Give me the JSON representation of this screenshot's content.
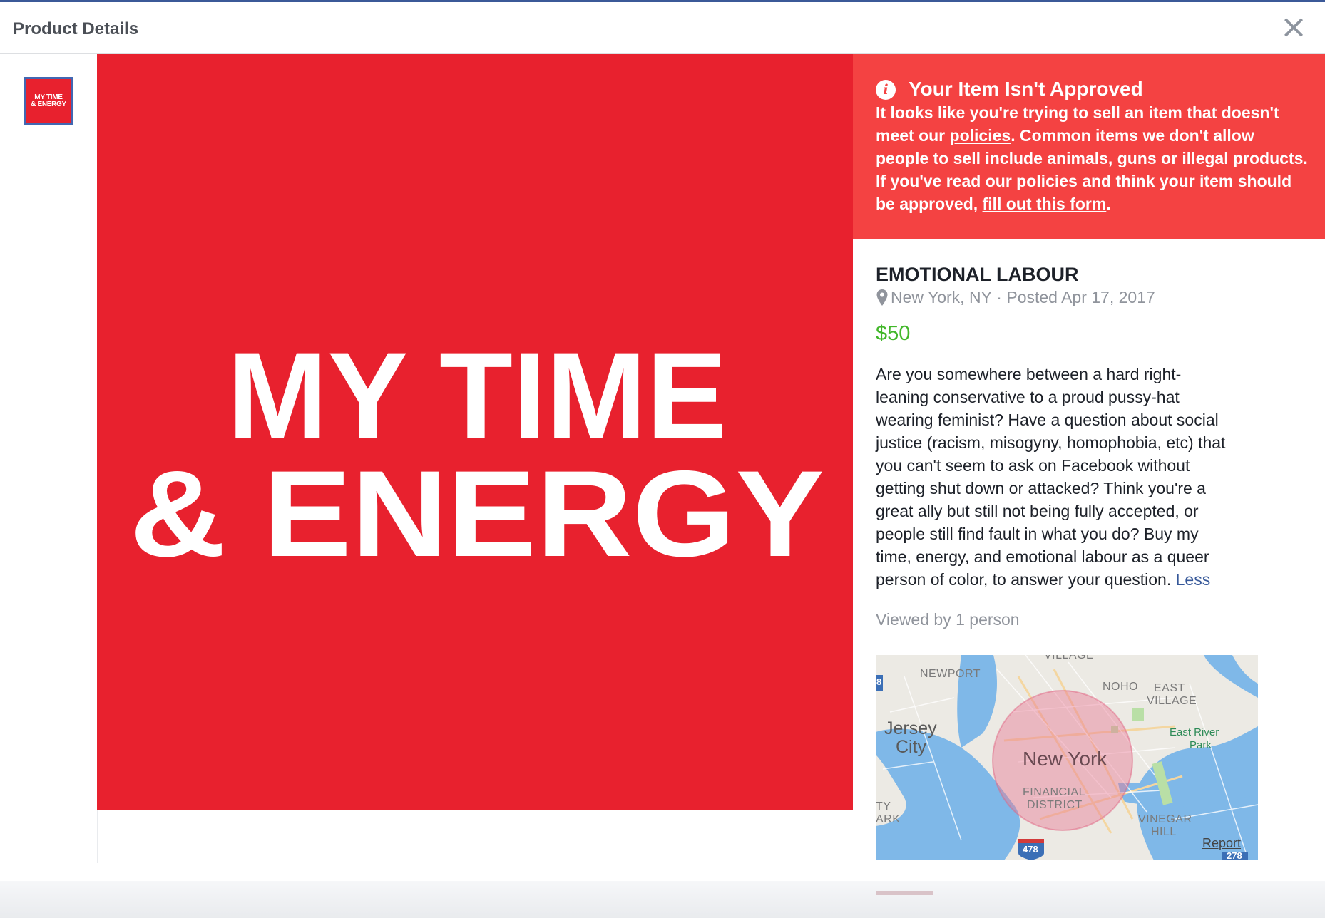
{
  "header": {
    "title": "Product Details",
    "close_symbol": "×"
  },
  "thumbnail": {
    "line1": "MY TIME",
    "line2": "& ENERGY"
  },
  "hero": {
    "line1": "MY TIME",
    "line2": "& ENERGY",
    "background_color": "#e8212e"
  },
  "alert": {
    "icon": "info-icon",
    "title": "Your Item Isn't Approved",
    "text_1": "It looks like you're trying to sell an item that doesn't meet our ",
    "link_policies": "policies",
    "text_2": ". Common items we don't allow people to sell include animals, guns or illegal products. If you've read our policies and think your item should be approved, ",
    "link_form": "fill out this form",
    "text_3": ".",
    "background_color": "#f44242"
  },
  "listing": {
    "title": "EMOTIONAL LABOUR",
    "location": "New York, NY",
    "separator": " · ",
    "posted": "Posted Apr 17, 2017",
    "price": "$50",
    "price_color": "#42b72a",
    "description_lines": [
      "Are you somewhere between a hard right-",
      "leaning conservative to a proud pussy-hat",
      "wearing feminist? Have a question about social",
      "justice (racism, misogyny, homophobia, etc) that",
      "you can't seem to ask on Facebook without",
      "getting shut down or attacked? Think you're a",
      "great ally but still not being fully accepted, or",
      "people still find fault in what you do? Buy my",
      "time, energy, and emotional labour as a queer",
      "person of color, to answer your question."
    ],
    "less_link": "Less",
    "views": "Viewed by 1 person"
  },
  "map": {
    "labels": {
      "village": "VILLAGE",
      "newport": "NEWPORT",
      "noho": "NOHO",
      "east_village_1": "EAST",
      "east_village_2": "VILLAGE",
      "jersey_1": "Jersey",
      "jersey_2": "City",
      "east_river_1": "East River",
      "east_river_2": "Park",
      "new_york": "New York",
      "fin_1": "FINANCIAL",
      "fin_2": "DISTRICT",
      "ty": "TY",
      "ark": "ARK",
      "vinegar_1": "VINEGAR",
      "vinegar_2": "HILL",
      "shield_478": "478",
      "shield_278": "278",
      "shield_8": "8"
    },
    "report_link": "Report"
  }
}
